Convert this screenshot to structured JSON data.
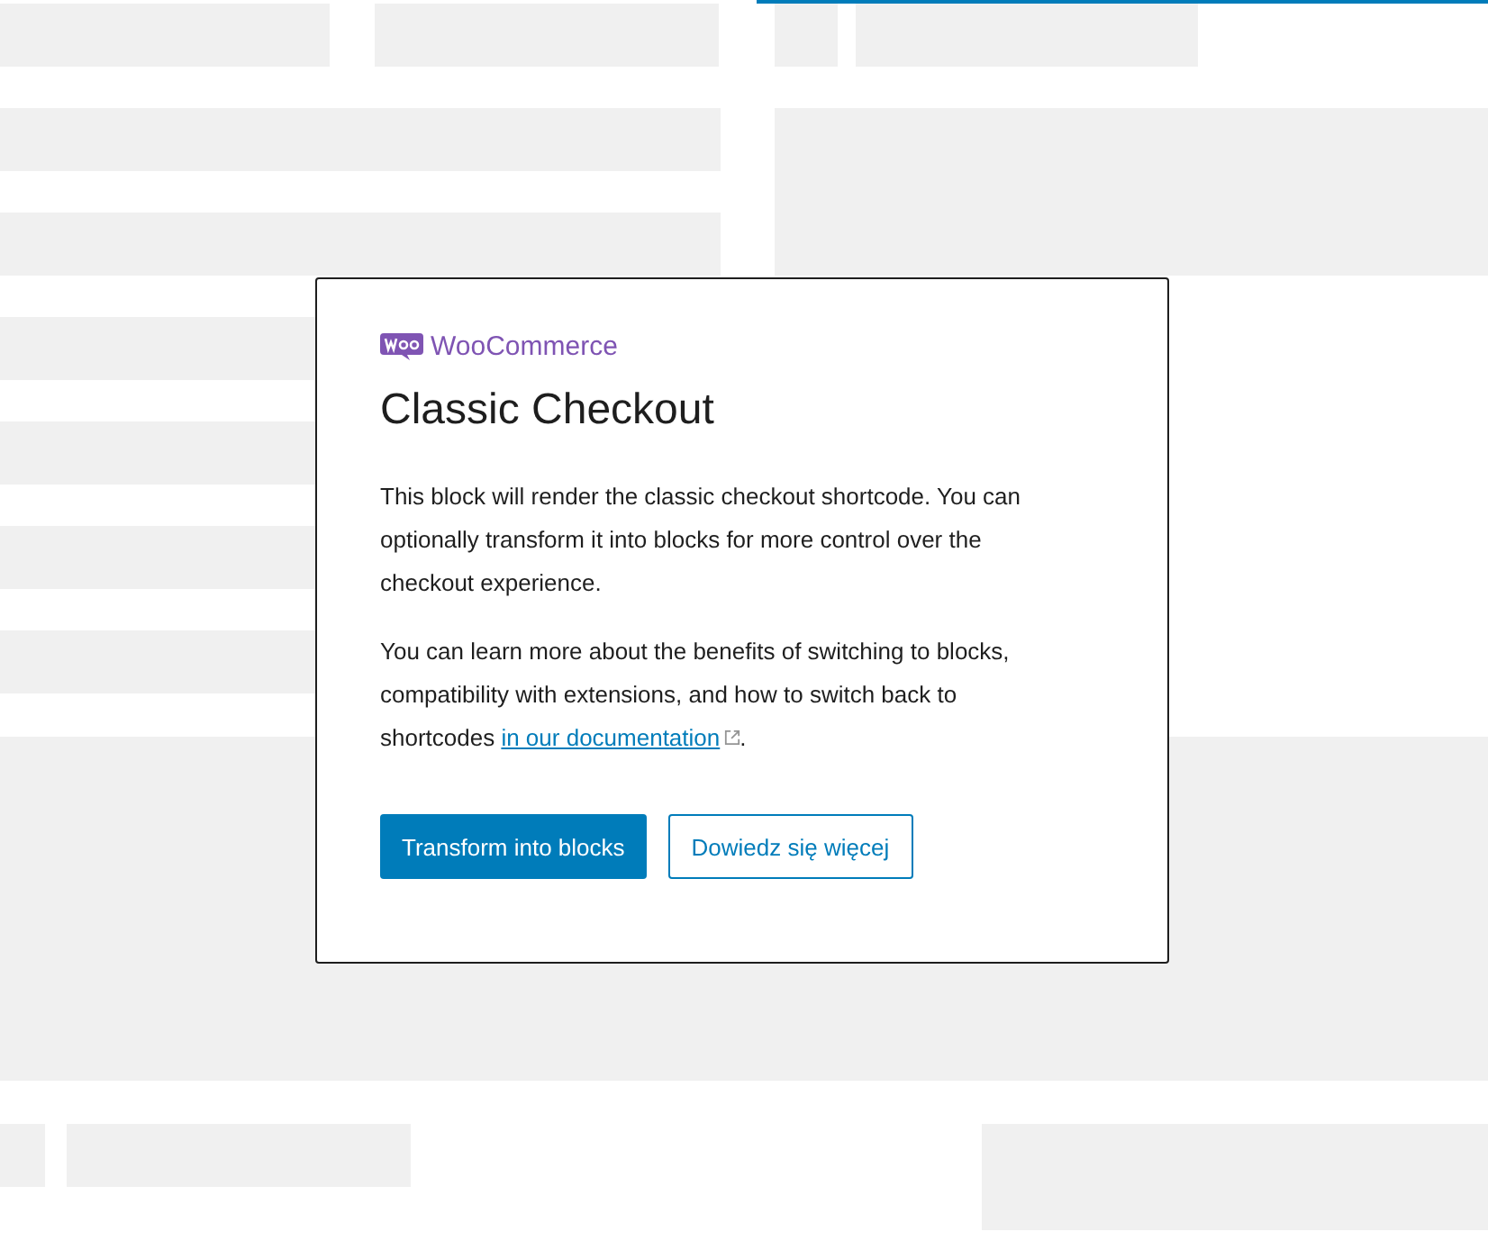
{
  "modal": {
    "brand": "WooCommerce",
    "title": "Classic Checkout",
    "paragraph_1": "This block will render the classic checkout shortcode. You can optionally transform it into blocks for more control over the checkout experience.",
    "paragraph_2_before": "You can learn more about the benefits of switching to blocks, compatibility with extensions, and how to switch back to shortcodes ",
    "paragraph_2_link": "in our documentation",
    "paragraph_2_after": ".",
    "buttons": [
      {
        "label": "Transform into blocks",
        "kind": "primary"
      },
      {
        "label": "Dowiedz się więcej",
        "kind": "secondary"
      }
    ]
  }
}
